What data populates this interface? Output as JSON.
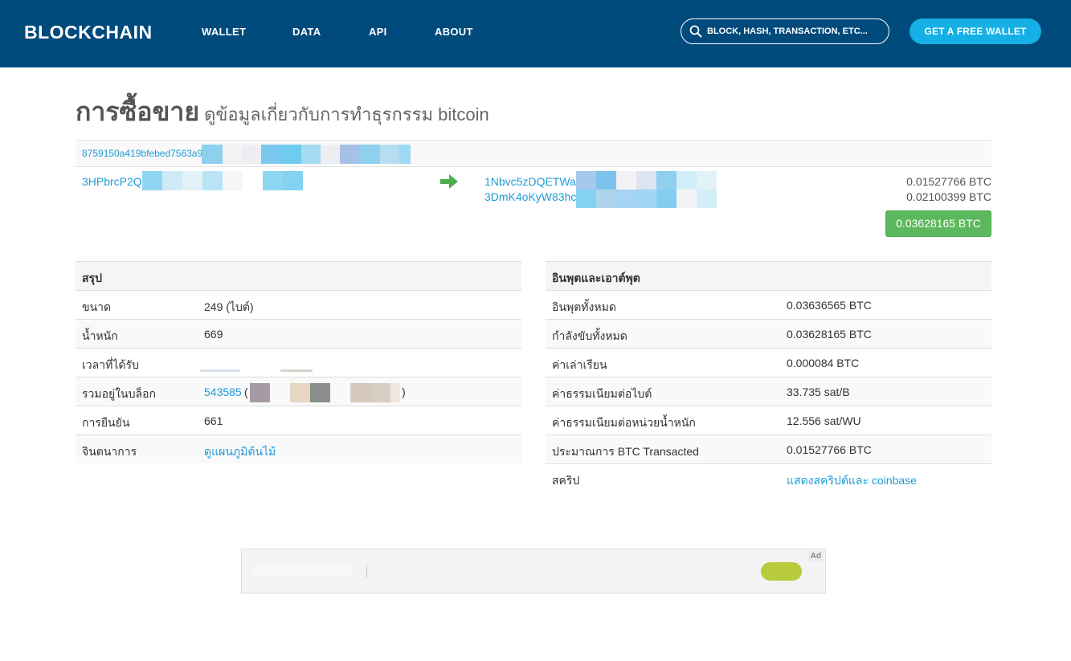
{
  "header": {
    "logo": "BLOCKCHAIN",
    "nav": [
      "WALLET",
      "DATA",
      "API",
      "ABOUT"
    ],
    "search_placeholder": "BLOCK, HASH, TRANSACTION, ETC...",
    "cta_label": "GET A FREE WALLET",
    "bg_color": "#004a7c",
    "cta_color": "#14b0e6"
  },
  "title": {
    "main": "การซื้อขาย",
    "sub": "ดูข้อมูลเกี่ยวกับการทำธุรกรรม bitcoin"
  },
  "tx": {
    "hash_prefix": "8759150a419bfebed7563a9",
    "input_address_prefix": "3HPbrcP2Q",
    "outputs": [
      {
        "address_prefix": "1Nbvc5zDQETWa",
        "amount": "0.01527766 BTC"
      },
      {
        "address_prefix": "3DmK4oKyW83hc",
        "amount": "0.02100399 BTC"
      }
    ],
    "total": "0.03628165 BTC",
    "arrow_icon": "right-arrow-icon"
  },
  "summary": {
    "heading": "สรุป",
    "rows": [
      {
        "label": "ขนาด",
        "value": "249 (ไบต์)"
      },
      {
        "label": "น้ำหนัก",
        "value": "669"
      },
      {
        "label": "เวลาที่ได้รับ",
        "value": ""
      },
      {
        "label": "รวมอยู่ในบล็อก",
        "value": "543585",
        "suffix_open": "(",
        "suffix_close": ")"
      },
      {
        "label": "การยืนยัน",
        "value": "661"
      },
      {
        "label": "จินตนาการ",
        "value": "ดูแผนภูมิต้นไม้"
      }
    ]
  },
  "io": {
    "heading": "อินพุตและเอาต์พุต",
    "rows": [
      {
        "label": "อินพุตทั้งหมด",
        "value": "0.03636565 BTC"
      },
      {
        "label": "กำลังขับทั้งหมด",
        "value": "0.03628165 BTC"
      },
      {
        "label": "ค่าเล่าเรียน",
        "value": "0.000084 BTC"
      },
      {
        "label": "ค่าธรรมเนียมต่อไบต์",
        "value": "33.735 sat/B"
      },
      {
        "label": "ค่าธรรมเนียมต่อหน่วยน้ำหนัก",
        "value": "12.556 sat/WU"
      },
      {
        "label": "ประมาณการ BTC Transacted",
        "value": "0.01527766 BTC"
      },
      {
        "label": "สคริป",
        "value": "แสดงสคริปต์และ coinbase"
      }
    ]
  },
  "ad": {
    "tag": "Ad"
  },
  "colors": {
    "link": "#1e9bd7",
    "total_badge": "#5cb85c"
  }
}
